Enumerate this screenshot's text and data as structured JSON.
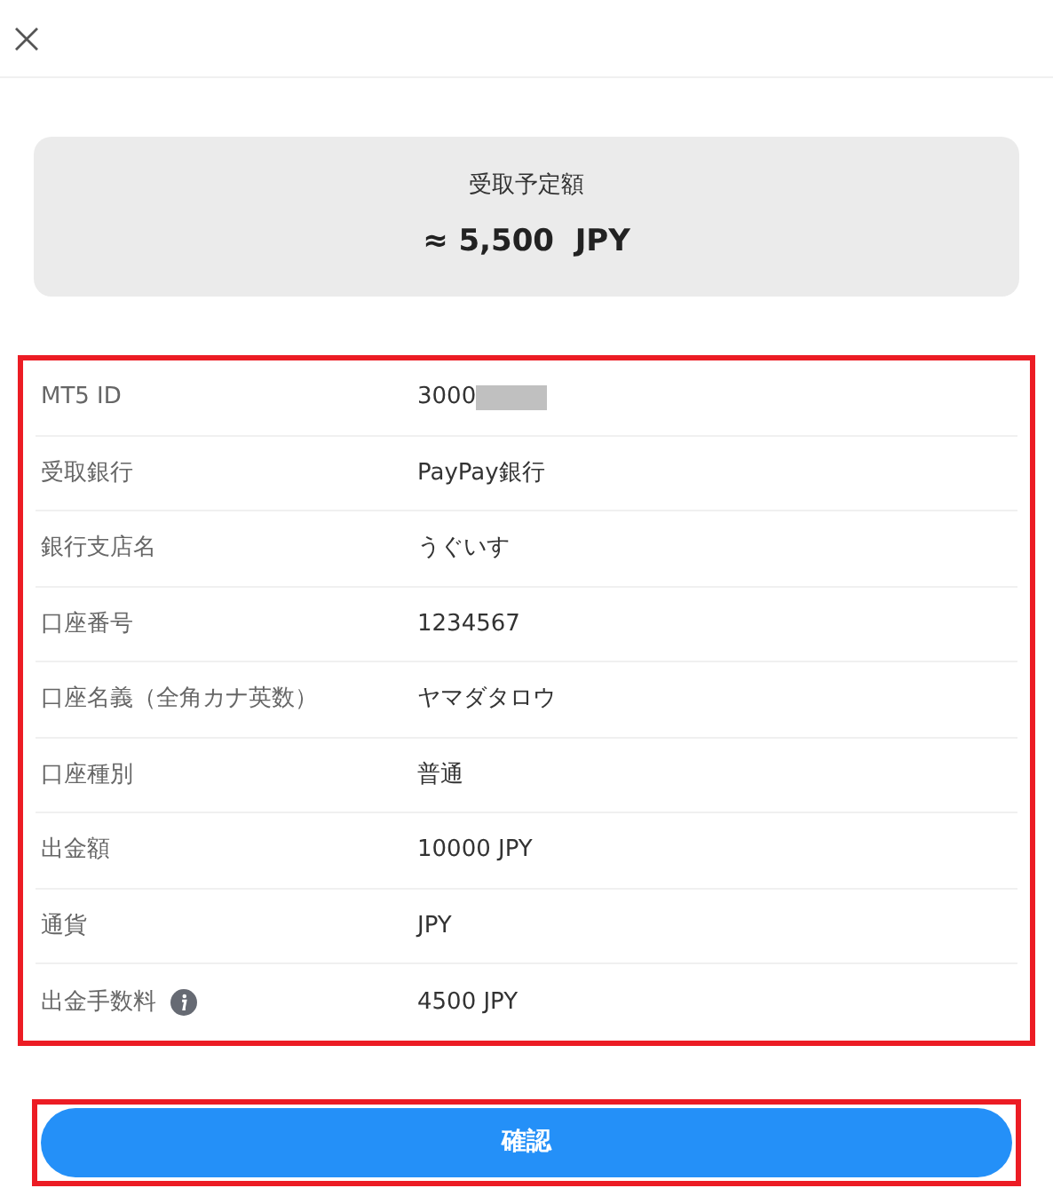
{
  "summary": {
    "label": "受取予定額",
    "amount": "≈ 5,500  JPY"
  },
  "details": [
    {
      "kind": "redacted",
      "label": "MT5 ID",
      "value": "3000"
    },
    {
      "kind": "plain",
      "label": "受取銀行",
      "value": "PayPay銀行"
    },
    {
      "kind": "plain",
      "label": "銀行支店名",
      "value": "うぐいす"
    },
    {
      "kind": "plain",
      "label": "口座番号",
      "value": "1234567"
    },
    {
      "kind": "plain",
      "label": "口座名義（全角カナ英数）",
      "value": "ヤマダタロウ"
    },
    {
      "kind": "plain",
      "label": "口座種別",
      "value": "普通"
    },
    {
      "kind": "plain",
      "label": "出金額",
      "value": "10000 JPY"
    },
    {
      "kind": "plain",
      "label": "通貨",
      "value": "JPY"
    },
    {
      "kind": "info",
      "label": "出金手数料",
      "value": "4500 JPY"
    }
  ],
  "confirm_button": "確認"
}
